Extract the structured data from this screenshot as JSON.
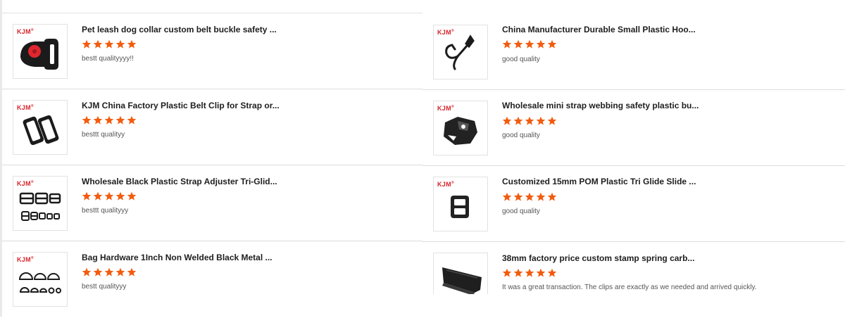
{
  "brand": "KJM",
  "brand_mark": "®",
  "star_color": "#f25c0f",
  "left_reviews": [
    {
      "title": "Pet leash dog collar custom belt buckle safety ...",
      "rating": 5,
      "text": "bestt qualityyyy!!",
      "brand_visible": true,
      "image_icon": "side-release-buckle-icon"
    },
    {
      "title": "KJM China Factory Plastic Belt Clip for Strap or...",
      "rating": 5,
      "text": "besttt qualityy",
      "brand_visible": true,
      "image_icon": "belt-loop-keeper-icon"
    },
    {
      "title": "Wholesale Black Plastic Strap Adjuster Tri-Glid...",
      "rating": 5,
      "text": "besttt qualityyy",
      "brand_visible": true,
      "image_icon": "tri-glide-set-icon"
    },
    {
      "title": "Bag Hardware 1Inch Non Welded Black Metal ...",
      "rating": 5,
      "text": "bestt qualityyy",
      "brand_visible": true,
      "image_icon": "d-ring-set-icon"
    }
  ],
  "right_reviews": [
    {
      "title": "China Manufacturer Durable Small Plastic Hoo...",
      "rating": 5,
      "text": "good quality",
      "brand_visible": true,
      "image_icon": "snap-hook-icon"
    },
    {
      "title": "Wholesale mini strap webbing safety plastic bu...",
      "rating": 5,
      "text": "good quality",
      "brand_visible": true,
      "image_icon": "safety-buckle-icon"
    },
    {
      "title": "Customized 15mm POM Plastic Tri Glide Slide ...",
      "rating": 5,
      "text": "good quality",
      "brand_visible": true,
      "image_icon": "tri-glide-icon"
    },
    {
      "title": "38mm factory price custom stamp spring carb...",
      "rating": 5,
      "text": "It was a great transaction. The clips are exactly as we needed and arrived quickly.",
      "brand_visible": false,
      "image_icon": "spring-clip-icon"
    }
  ]
}
